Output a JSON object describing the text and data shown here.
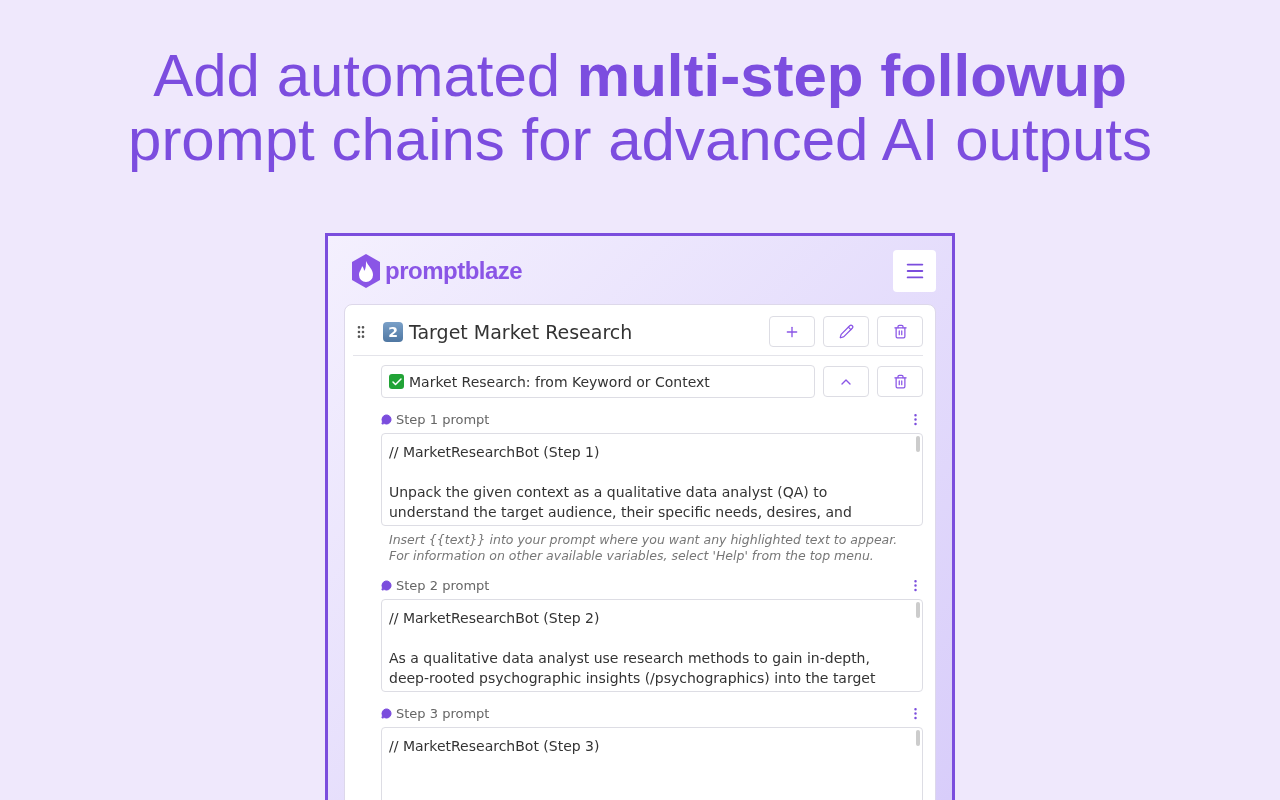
{
  "headline": {
    "line_1": "Add automated **multi-step followup**",
    "line_2": "prompt chains for advanced AI outputs"
  },
  "app": {
    "logo": "promptblaze",
    "folder": {
      "number": "2",
      "title": "Target Market Research",
      "prompt": {
        "title": "Market Research: from Keyword or Context",
        "checked": true
      },
      "steps": [
        {
          "label": "Step 1 prompt",
          "first_line": "// MarketResearchBot (Step 1)",
          "body": "Unpack the given context as a qualitative data analyst (QA) to understand the target audience, their specific needs, desires, and",
          "hint": "Insert {{text}} into your prompt where you want any highlighted text to appear. For information on other available variables, select 'Help' from the top menu."
        },
        {
          "label": "Step 2 prompt",
          "first_line": "// MarketResearchBot (Step 2)",
          "body": "As a qualitative data analyst use research methods to gain in-depth, deep-rooted psychographic insights (/psychographics) into the target"
        },
        {
          "label": "Step 3 prompt",
          "first_line": "// MarketResearchBot (Step 3)"
        }
      ]
    }
  }
}
